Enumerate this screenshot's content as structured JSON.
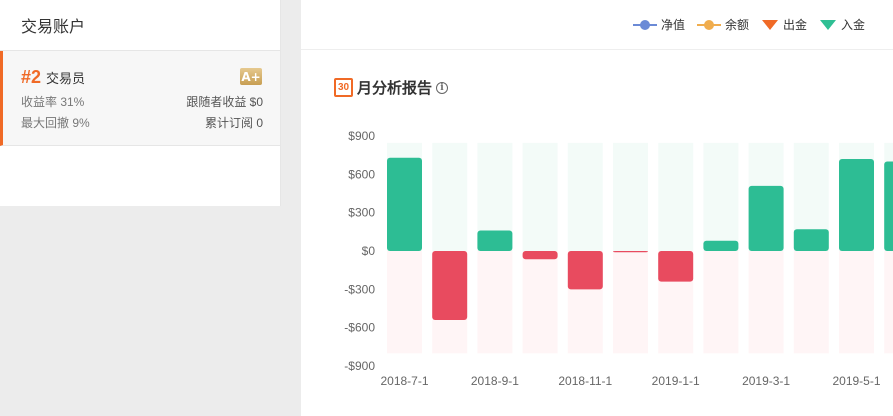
{
  "left": {
    "header_title": "交易账户",
    "account": {
      "rank": "#2",
      "name": "交易员",
      "grade": "A+",
      "return_rate_label": "收益率 31%",
      "follower_income_label": "跟随者收益 $0",
      "max_drawdown_label": "最大回撤 9%",
      "subscriptions_label": "累计订阅 0"
    }
  },
  "legend": [
    {
      "label": "净值",
      "color": "#6b8ad6",
      "icon": "line-circle-icon"
    },
    {
      "label": "余额",
      "color": "#f0ad4e",
      "icon": "line-circle-icon"
    },
    {
      "label": "出金",
      "color": "#f06a26",
      "icon": "triangle-down-icon"
    },
    {
      "label": "入金",
      "color": "#2fbf94",
      "icon": "triangle-down-icon"
    }
  ],
  "report": {
    "title": "月分析报告",
    "calendar_icon_text": "30",
    "info_icon_text": "i"
  },
  "chart_data": {
    "type": "bar",
    "categories": [
      "2018-7",
      "2018-8",
      "2018-9",
      "2018-10",
      "2018-11",
      "2018-12",
      "2019-1",
      "2019-2",
      "2019-3",
      "2019-4",
      "2019-5",
      "2019-6"
    ],
    "values": [
      730,
      -540,
      160,
      -65,
      -300,
      -10,
      -240,
      80,
      510,
      170,
      720,
      700
    ],
    "x_tick_labels": [
      "2018-7-1",
      "2018-9-1",
      "2018-11-1",
      "2019-1-1",
      "2019-3-1",
      "2019-5-1"
    ],
    "y_ticks": [
      900,
      600,
      300,
      0,
      -300,
      -600,
      -900
    ],
    "y_tick_labels": [
      "$900",
      "$600",
      "$300",
      "$0",
      "-$300",
      "-$600",
      "-$900"
    ],
    "ylim": [
      -900,
      900
    ],
    "positive_color": "#2dbd94",
    "negative_color": "#e84b5f",
    "positive_bg_color": "#f3fbf8",
    "negative_bg_color": "#fff5f6"
  }
}
